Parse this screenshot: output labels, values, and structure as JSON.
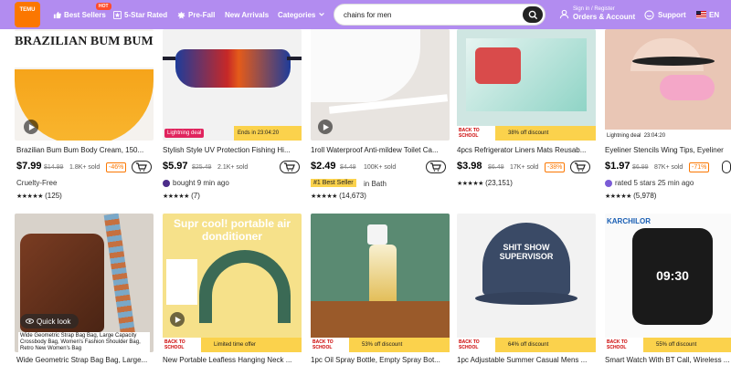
{
  "header": {
    "logo_line1": "TEMU",
    "nav": [
      {
        "label": "Best Sellers",
        "icon": "thumbs-up-icon"
      },
      {
        "label": "5-Star Rated",
        "icon": "star-icon"
      },
      {
        "label": "Pre-Fall",
        "icon": "leaf-icon"
      },
      {
        "label": "New Arrivals",
        "icon": ""
      },
      {
        "label": "Categories",
        "icon": "chevron-down-icon"
      }
    ],
    "hot_badge": "HOT",
    "search_value": "chains for men",
    "signin_line1": "Sign in / Register",
    "signin_line2": "Orders & Account",
    "support": "Support",
    "lang": "EN"
  },
  "colors": {
    "header_bg": "#b28cf0",
    "accent": "#fb7701",
    "deal_bar": "#fbd24c"
  },
  "row1": [
    {
      "title": "Brazilian Bum Bum Body Cream, 150...",
      "price": "$7.99",
      "orig": "$14.99",
      "sold": "1.8K+ sold",
      "disc": "-46%",
      "sub": "Cruelty-Free",
      "rating": "(125)",
      "img_text": "BRAZILIAN BUM BUM CREAM"
    },
    {
      "title": "Stylish Style UV Protection Fishing Hi...",
      "price": "$5.97",
      "orig": "$25.49",
      "sold": "2.1K+ sold",
      "disc": "",
      "sub": "bought 9 min ago",
      "rating": "(7)",
      "flash": "Lightning deal",
      "ends": "Ends in 23:04:20"
    },
    {
      "title": "1roll Waterproof Anti-mildew Toilet Ca...",
      "price": "$2.49",
      "orig": "$4.49",
      "sold": "100K+ sold",
      "disc": "",
      "sub": "in Bath",
      "best": "#1 Best Seller",
      "rating": "(14,673)"
    },
    {
      "title": "4pcs Refrigerator Liners Mats Reusab...",
      "price": "$3.98",
      "orig": "$6.49",
      "sold": "17K+ sold",
      "disc": "-38%",
      "sub": "",
      "rating": "(23,151)",
      "deal": "38% off discount",
      "tag": "BACK TO SCHOOL"
    },
    {
      "title": "Eyeliner Stencils Wing Tips, Eyeliner",
      "price": "$1.97",
      "orig": "$6.99",
      "sold": "87K+ sold",
      "disc": "-71%",
      "sub": "rated 5 stars 25 min ago",
      "rating": "(5,978)",
      "flash": "Lightning deal",
      "ends": "23:04:20"
    }
  ],
  "row2": [
    {
      "title": "Wide Geometric Strap Bag Bag, Large...",
      "quick": "Quick look",
      "overlay": "Wide Geometric Strap Bag Bag, Large Capacity Crossbody Bag, Women's Fashion Shoulder Bag, Retro New Women's Bag"
    },
    {
      "title": "New Portable Leafless Hanging Neck ...",
      "img_text": "Supr cool! portable air donditioner",
      "deal": "Limited time offer",
      "tag": "BACK TO SCHOOL"
    },
    {
      "title": "1pc Oil Spray Bottle, Empty Spray Bot...",
      "deal": "53% off discount",
      "tag": "BACK TO SCHOOL"
    },
    {
      "title": "1pc Adjustable Summer Casual Mens ...",
      "deal": "64% off discount",
      "tag": "BACK TO SCHOOL",
      "img_text": "SHIT SHOW SUPERVISOR"
    },
    {
      "title": "Smart Watch With BT Call, Wireless ...",
      "deal": "55% off discount",
      "tag": "BACK TO SCHOOL",
      "img_text": "KARCHILOR",
      "time": "09:30"
    }
  ],
  "stars": "★★★★★"
}
